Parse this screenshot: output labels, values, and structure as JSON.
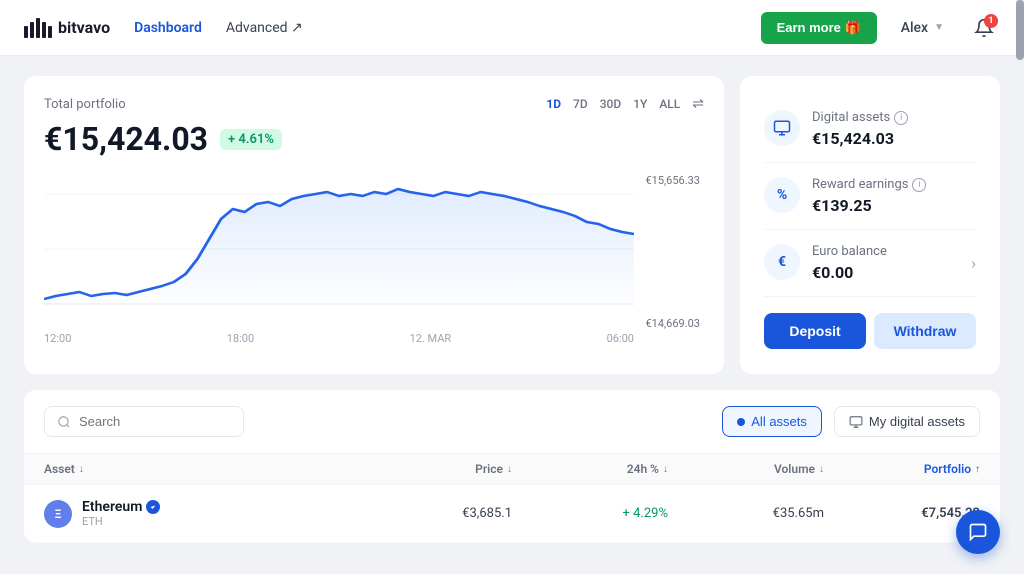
{
  "header": {
    "logo_text": "bitvavo",
    "nav": [
      {
        "label": "Dashboard",
        "active": true
      },
      {
        "label": "Advanced ↗",
        "active": false
      }
    ],
    "earn_more_label": "Earn more 🎁",
    "user_label": "Alex",
    "notification_count": "1"
  },
  "chart_card": {
    "label": "Total portfolio",
    "value": "€15,424.03",
    "change": "+ 4.61%",
    "time_filters": [
      "1D",
      "7D",
      "30D",
      "1Y",
      "ALL",
      "⇌"
    ],
    "active_filter": "1D",
    "max_label": "€15,656.33",
    "min_label": "€14,669.03",
    "x_labels": [
      "12:00",
      "18:00",
      "12. MAR",
      "06:00"
    ]
  },
  "sidebar": {
    "digital_assets_label": "Digital assets",
    "digital_assets_value": "€15,424.03",
    "reward_earnings_label": "Reward earnings",
    "reward_earnings_value": "€139.25",
    "euro_balance_label": "Euro balance",
    "euro_balance_value": "€0.00",
    "deposit_label": "Deposit",
    "withdraw_label": "Withdraw"
  },
  "assets": {
    "search_placeholder": "Search",
    "all_assets_label": "All assets",
    "my_digital_assets_label": "My digital assets",
    "columns": [
      "Asset",
      "Price",
      "24h %",
      "Volume",
      "Portfolio"
    ],
    "rows": [
      {
        "name": "Ethereum",
        "ticker": "ETH",
        "icon_bg": "#627eea",
        "icon_text": "Ξ",
        "verified": true,
        "price": "€3,685.1",
        "change_24h": "+ 4.29%",
        "volume": "€35.65m",
        "portfolio": "€7,545.22",
        "portfolio_sub": ""
      }
    ]
  },
  "icons": {
    "search": "🔍",
    "gift": "🎁",
    "bell": "🔔",
    "digital_asset_icon": "📊",
    "reward_icon": "%",
    "euro_icon": "€",
    "chat": "💬"
  }
}
